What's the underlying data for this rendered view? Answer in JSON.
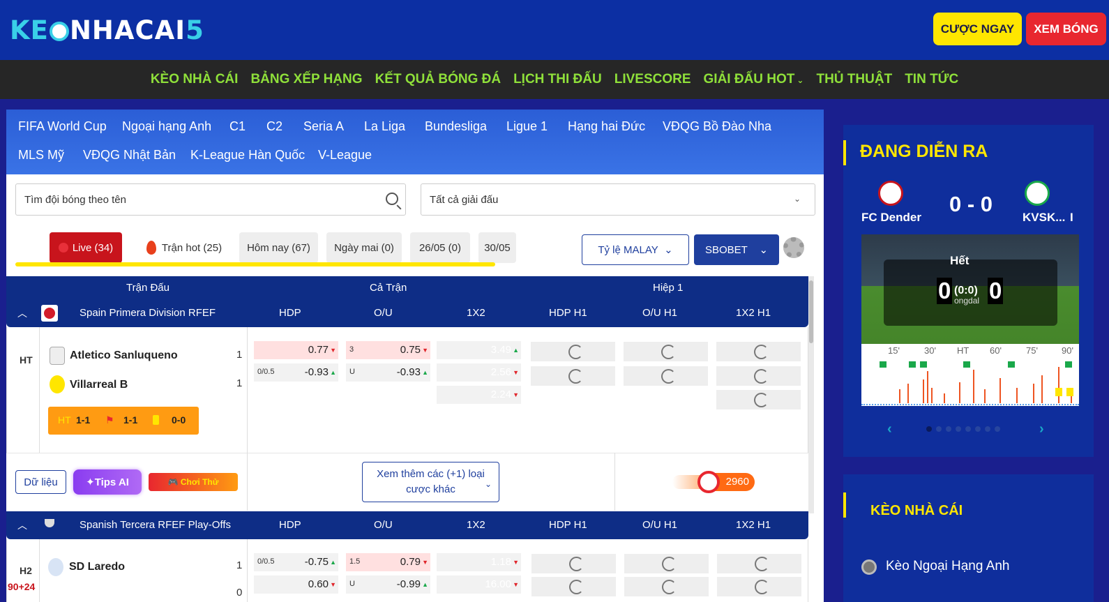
{
  "header": {
    "logo": {
      "prefix": "K",
      "e": "E",
      "main": "NHACAI",
      "five": "5"
    },
    "bet_button": "CƯỢC NGAY",
    "watch_button": "XEM BÓNG"
  },
  "nav": [
    "KÈO NHÀ CÁI",
    "BẢNG XẾP HẠNG",
    "KẾT QUẢ BÓNG ĐÁ",
    "LỊCH THI ĐẤU",
    "LIVESCORE",
    "GIẢI ĐẤU HOT",
    "THỦ THUẬT",
    "TIN TỨC"
  ],
  "leagues": [
    "FIFA World Cup",
    "Ngoại hạng Anh",
    "C1",
    "C2",
    "Seria A",
    "La Liga",
    "Bundesliga",
    "Ligue 1",
    "Hạng hai Đức",
    "VĐQG Bồ Đào Nha",
    "MLS Mỹ",
    "VĐQG Nhật Bản",
    "K-League Hàn Quốc",
    "V-League"
  ],
  "search": {
    "placeholder": "Tìm đội bóng theo tên"
  },
  "tournament_select": {
    "value": "Tất cả giải đấu"
  },
  "tabs": {
    "live": "Live (34)",
    "hot": "Trận hot (25)",
    "today": "Hôm nay (67)",
    "tomorrow": "Ngày mai (0)",
    "d1": "26/05 (0)",
    "d2": "30/05"
  },
  "rate_select": "Tỷ lệ MALAY",
  "bookmaker_select": "SBOBET",
  "table_head": {
    "match": "Trận Đấu",
    "full": "Cả Trận",
    "half": "Hiệp 1"
  },
  "columns": [
    "HDP",
    "O/U",
    "1X2",
    "HDP H1",
    "O/U H1",
    "1X2 H1"
  ],
  "leagues_block": [
    {
      "name": "Spain Primera Division RFEF",
      "match": {
        "status": "HT",
        "home": "Atletico Sanluqueno",
        "away": "Villarreal B",
        "home_score": "1",
        "away_score": "1",
        "stats": {
          "ht_label": "HT",
          "ht": "1-1",
          "corners": "1-1",
          "cards": "0-0"
        },
        "hdp": {
          "line": "0/0.5",
          "home": "0.77",
          "away": "-0.93"
        },
        "ou": {
          "line": "3",
          "under": "U",
          "over": "0.75",
          "u_val": "-0.93"
        },
        "x12": [
          "3.49",
          "2.56",
          "2.24"
        ]
      },
      "actions": {
        "data": "Dữ liệu",
        "tips": "Tips AI",
        "play": "Chơi Thử",
        "more_line1": "Xem thêm các (+1) loại",
        "more_line2": "cược khác",
        "count": "2960"
      }
    },
    {
      "name": "Spanish Tercera RFEF Play-Offs",
      "match": {
        "status": "H2",
        "minute": "90+24",
        "home": "SD Laredo",
        "home_score": "1",
        "away_score": "0",
        "hdp": {
          "line": "0/0.5",
          "home": "-0.75",
          "away": "0.60"
        },
        "ou": {
          "line": "1.5",
          "under": "U",
          "over": "0.79",
          "u_val": "-0.99"
        },
        "x12": [
          "1.18",
          "16.00"
        ]
      }
    }
  ],
  "sidebar_live": {
    "title": "ĐANG DIỄN RA",
    "home": "FC Dender",
    "away": "KVSK...",
    "away_extra": "I",
    "score": "0 - 0",
    "state": "Hết",
    "home_big": "0",
    "away_big": "0",
    "ht_score": "(0:0)",
    "sub": "ongdal",
    "timeline": [
      "15'",
      "30'",
      "HT",
      "60'",
      "75'",
      "90'"
    ]
  },
  "sidebar_odds": {
    "title": "KÈO NHÀ CÁI",
    "item": "Kèo Ngoại Hạng Anh"
  },
  "colors": {
    "header_bg": "#0c2fa3",
    "nav_text": "#8fe03a",
    "accent_yellow": "#ffe600",
    "live_red": "#c8141c",
    "table_head": "#0e2d86"
  }
}
